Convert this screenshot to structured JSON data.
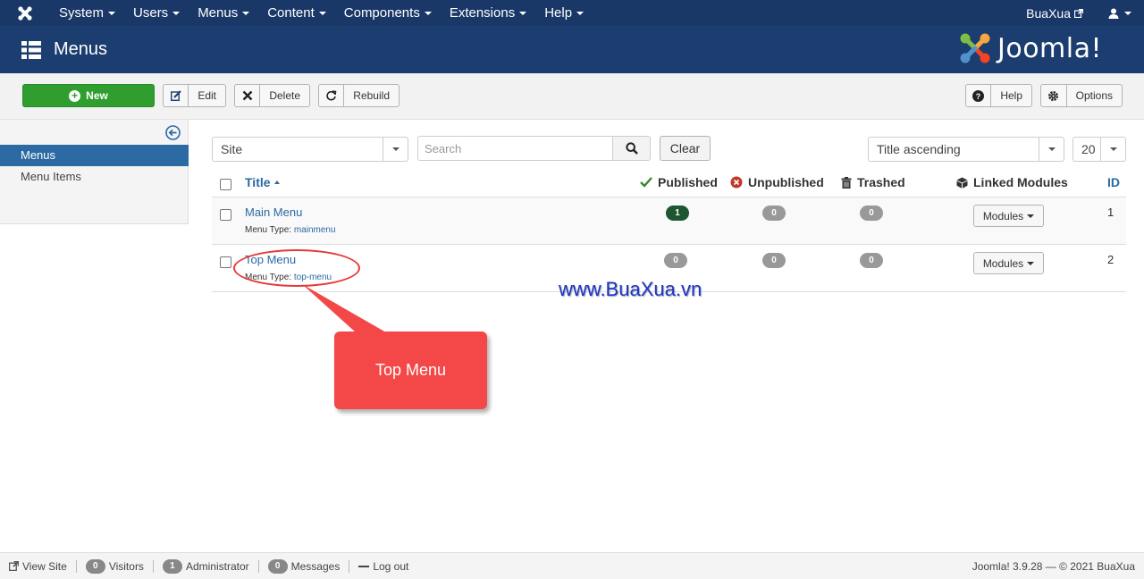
{
  "topbar": {
    "menus": [
      "System",
      "Users",
      "Menus",
      "Content",
      "Components",
      "Extensions",
      "Help"
    ],
    "site_name": "BuaXua"
  },
  "header": {
    "title": "Menus",
    "brand": "Joomla!"
  },
  "toolbar": {
    "new_label": "New",
    "edit_label": "Edit",
    "delete_label": "Delete",
    "rebuild_label": "Rebuild",
    "help_label": "Help",
    "options_label": "Options"
  },
  "sidebar": {
    "items": [
      {
        "label": "Menus",
        "active": true
      },
      {
        "label": "Menu Items",
        "active": false
      }
    ]
  },
  "filters": {
    "client": "Site",
    "search_placeholder": "Search",
    "clear_label": "Clear",
    "ordering": "Title ascending",
    "limit": "20"
  },
  "table": {
    "headers": {
      "title": "Title",
      "published": "Published",
      "unpublished": "Unpublished",
      "trashed": "Trashed",
      "linked_modules": "Linked Modules",
      "id": "ID"
    },
    "menu_type_label": "Menu Type:",
    "modules_label": "Modules",
    "rows": [
      {
        "title": "Main Menu",
        "menu_type": "mainmenu",
        "published": "1",
        "unpublished": "0",
        "trashed": "0",
        "id": "1"
      },
      {
        "title": "Top Menu",
        "menu_type": "top-menu",
        "published": "0",
        "unpublished": "0",
        "trashed": "0",
        "id": "2"
      }
    ]
  },
  "annotation": {
    "callout": "Top Menu",
    "watermark": "www.BuaXua.vn"
  },
  "footer": {
    "view_site": "View Site",
    "visitors_count": "0",
    "visitors_label": "Visitors",
    "admin_count": "1",
    "admin_label": "Administrator",
    "messages_count": "0",
    "messages_label": "Messages",
    "logout": "Log out",
    "copyright": "Joomla! 3.9.28 — © 2021 BuaXua"
  },
  "colors": {
    "topbar": "#1a3867",
    "header": "#1c3d6f",
    "new_button": "#2f9e2f",
    "link": "#2a69a5",
    "callout": "#f44848",
    "published_badge": "#1d5631"
  }
}
